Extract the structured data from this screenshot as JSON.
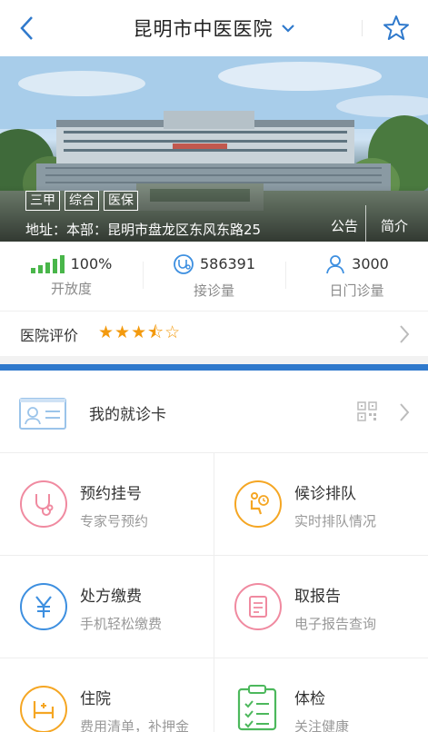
{
  "header": {
    "title": "昆明市中医医院"
  },
  "hero": {
    "tags": [
      "三甲",
      "综合",
      "医保"
    ],
    "address": "地址：本部：昆明市盘龙区东风东路25",
    "announce_label": "公告",
    "intro_label": "简介"
  },
  "stats": [
    {
      "value": "100%",
      "label": "开放度",
      "icon": "signal-bars-icon"
    },
    {
      "value": "586391",
      "label": "接诊量",
      "icon": "stethoscope-icon"
    },
    {
      "value": "3000",
      "label": "日门诊量",
      "icon": "person-icon"
    }
  ],
  "rating": {
    "label": "医院评价",
    "stars": "★★★⯪☆",
    "score": 3.5,
    "max": 5
  },
  "card": {
    "label": "我的就诊卡"
  },
  "services": [
    {
      "title": "预约挂号",
      "subtitle": "专家号预约",
      "icon": "stethoscope-icon",
      "color": "#f08aa0"
    },
    {
      "title": "候诊排队",
      "subtitle": "实时排队情况",
      "icon": "waiting-icon",
      "color": "#f5a623"
    },
    {
      "title": "处方缴费",
      "subtitle": "手机轻松缴费",
      "icon": "yuan-icon",
      "color": "#3d8fe0"
    },
    {
      "title": "取报告",
      "subtitle": "电子报告查询",
      "icon": "report-icon",
      "color": "#f08aa0"
    },
    {
      "title": "住院",
      "subtitle": "费用清单，补押金",
      "icon": "hospital-bed-icon",
      "color": "#f5a623"
    },
    {
      "title": "体检",
      "subtitle": "关注健康",
      "icon": "checklist-icon",
      "color": "#4cb85c"
    }
  ],
  "colors": {
    "accent": "#2f79cc",
    "star": "#f39a0e",
    "signal": "#49b64a"
  }
}
